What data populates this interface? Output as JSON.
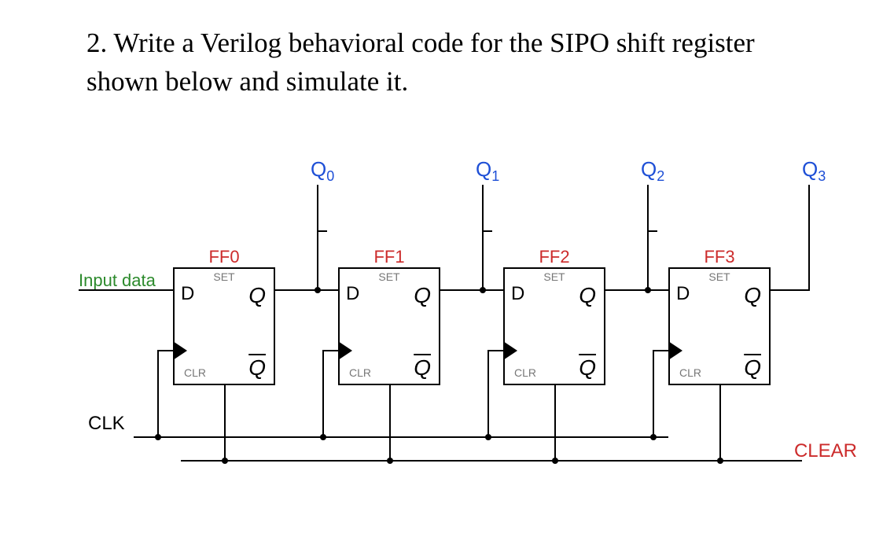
{
  "question": {
    "text": "2. Write a Verilog behavioral code for the SIPO shift register shown below and simulate it."
  },
  "diagram": {
    "outputs": [
      "Q",
      "Q",
      "Q",
      "Q"
    ],
    "output_subs": [
      "0",
      "1",
      "2",
      "3"
    ],
    "flipflops": [
      {
        "name": "FF0",
        "set": "SET",
        "clr": "CLR",
        "d": "D",
        "q": "Q",
        "qbar": "Q"
      },
      {
        "name": "FF1",
        "set": "SET",
        "clr": "CLR",
        "d": "D",
        "q": "Q",
        "qbar": "Q"
      },
      {
        "name": "FF2",
        "set": "SET",
        "clr": "CLR",
        "d": "D",
        "q": "Q",
        "qbar": "Q"
      },
      {
        "name": "FF3",
        "set": "SET",
        "clr": "CLR",
        "d": "D",
        "q": "Q",
        "qbar": "Q"
      }
    ],
    "input_label": "Input data",
    "clk_label": "CLK",
    "clear_label": "CLEAR"
  }
}
